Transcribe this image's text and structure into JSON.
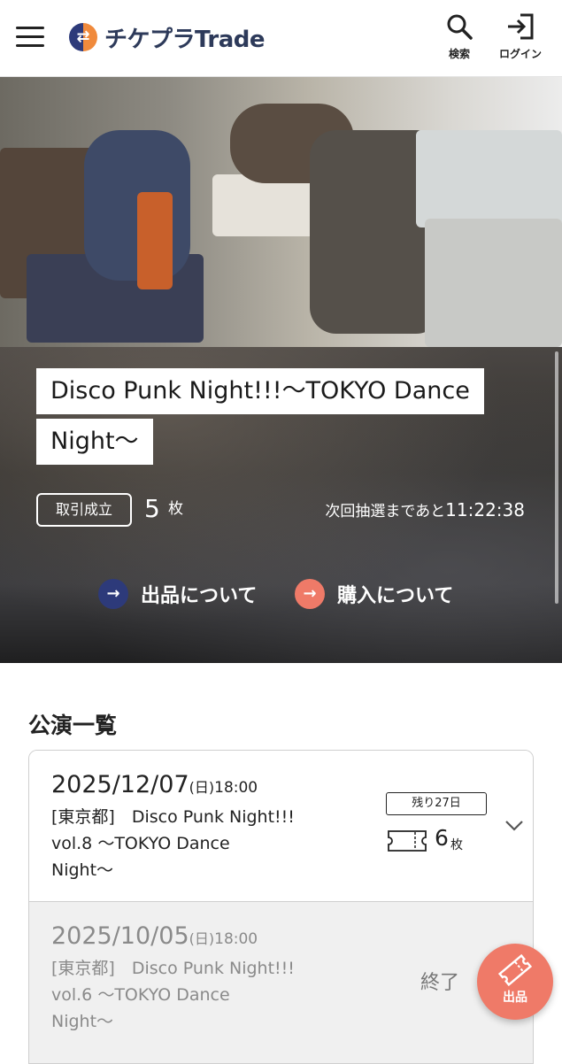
{
  "header": {
    "brand": "チケプラTrade",
    "search_label": "検索",
    "login_label": "ログイン"
  },
  "hero": {
    "title_line1": "Disco Punk Night!!!〜TOKYO Dance",
    "title_line2": "Night〜",
    "deal_badge": "取引成立",
    "deal_count": "5",
    "deal_unit": "枚",
    "next_lottery_label": "次回抽選まであと",
    "next_lottery_time": "11:22:38",
    "sell_guide": "出品について",
    "buy_guide": "購入について",
    "sell_color": "#2d3a7a",
    "buy_color": "#ef7a68"
  },
  "performances": {
    "section_title": "公演一覧",
    "items": [
      {
        "date": "2025/12/07",
        "weekday": "(日)",
        "time": "18:00",
        "name_line1": "[東京都]　Disco Punk Night!!!",
        "name_line2": "vol.8 〜TOKYO Dance",
        "name_line3": "Night〜",
        "remaining": "残り27日",
        "tickets": "6",
        "tickets_unit": "枚"
      },
      {
        "date": "2025/10/05",
        "weekday": "(日)",
        "time": "18:00",
        "name_line1": "[東京都]　Disco Punk Night!!!",
        "name_line2": "vol.6 〜TOKYO Dance",
        "name_line3": "Night〜",
        "status": "終了"
      }
    ]
  },
  "fab": {
    "label": "出品"
  }
}
